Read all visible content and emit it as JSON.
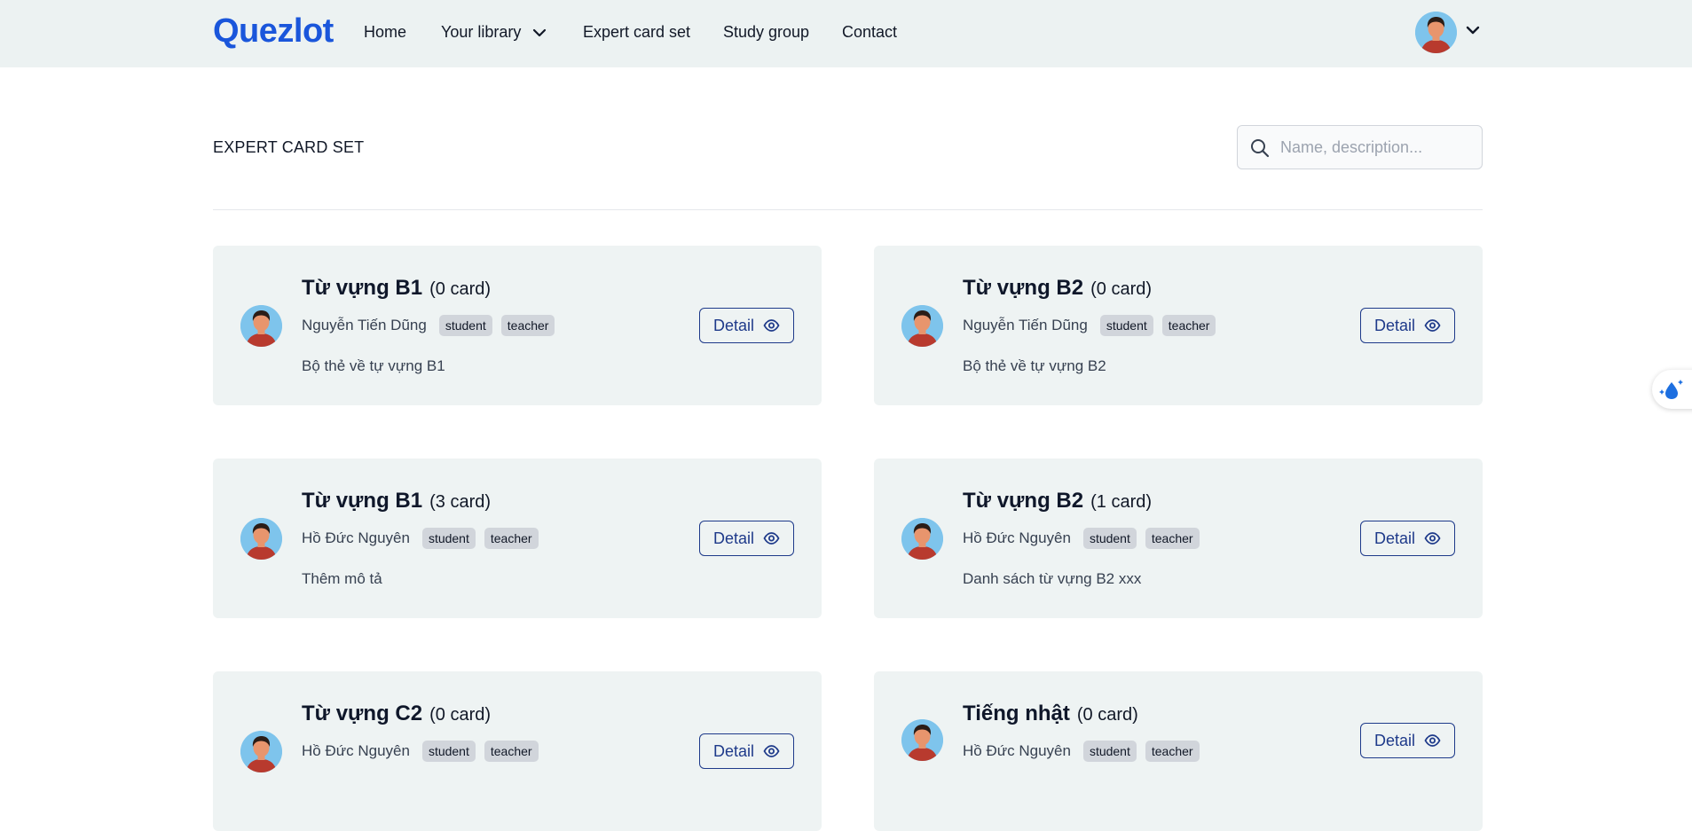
{
  "navbar": {
    "logo": "Quezlot",
    "links": [
      "Home",
      "Your library",
      "Expert card set",
      "Study group",
      "Contact"
    ]
  },
  "page": {
    "title": "EXPERT CARD SET"
  },
  "search": {
    "placeholder": "Name, description...",
    "value": ""
  },
  "cards": [
    {
      "title": "Từ vựng B1",
      "count": "(0 card)",
      "author": "Nguyễn Tiến Dũng",
      "roles": [
        "student",
        "teacher"
      ],
      "description": "Bộ thẻ về tự vựng B1",
      "button": "Detail"
    },
    {
      "title": "Từ vựng B2",
      "count": "(0 card)",
      "author": "Nguyễn Tiến Dũng",
      "roles": [
        "student",
        "teacher"
      ],
      "description": "Bộ thẻ về tự vựng B2",
      "button": "Detail"
    },
    {
      "title": "Từ vựng B1",
      "count": "(3 card)",
      "author": "Hồ Đức Nguyên",
      "roles": [
        "student",
        "teacher"
      ],
      "description": "Thêm mô tả",
      "button": "Detail"
    },
    {
      "title": "Từ vựng B2",
      "count": "(1 card)",
      "author": "Hồ Đức Nguyên",
      "roles": [
        "student",
        "teacher"
      ],
      "description": "Danh sách từ vựng B2 xxx",
      "button": "Detail"
    },
    {
      "title": "Từ vựng C2",
      "count": "(0 card)",
      "author": "Hồ Đức Nguyên",
      "roles": [
        "student",
        "teacher"
      ],
      "description": "",
      "button": "Detail"
    },
    {
      "title": "Tiếng nhật",
      "count": "(0 card)",
      "author": "Hồ Đức Nguyên",
      "roles": [
        "student",
        "teacher"
      ],
      "description": "",
      "button": "Detail"
    }
  ],
  "colors": {
    "brand": "#1a56db",
    "navbar_bg": "#ecf2f2",
    "card_bg": "#eef3f3",
    "button_border": "#1e3a8a"
  },
  "icons": [
    "chevron-down-icon",
    "user-avatar-icon",
    "search-icon",
    "eye-icon",
    "water-drop-sparkle-icon"
  ]
}
